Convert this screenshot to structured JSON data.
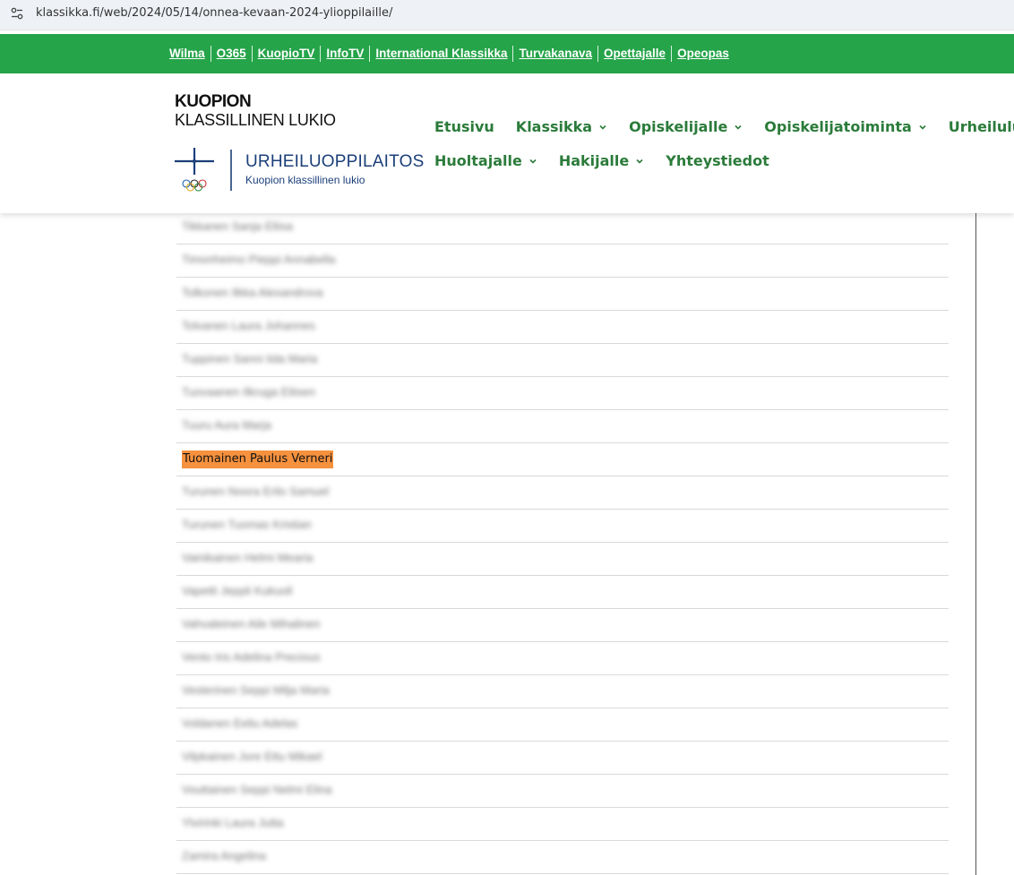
{
  "browser": {
    "url": "klassikka.fi/web/2024/05/14/onnea-kevaan-2024-ylioppilaille/",
    "site_info_icon": "tune-icon"
  },
  "topbar": {
    "links": [
      "Wilma",
      "O365",
      "KuopioTV",
      "InfoTV",
      "International Klassikka",
      "Turvakanava",
      "Opettajalle",
      "Opeopas"
    ]
  },
  "logo": {
    "line1": "KUOPION",
    "line2": "KLASSILLINEN LUKIO",
    "sport_title": "URHEILUOPPILAITOS",
    "sport_subtitle": "Kuopion klassillinen lukio"
  },
  "nav": {
    "row1": [
      {
        "label": "Etusivu",
        "dropdown": false
      },
      {
        "label": "Klassikka",
        "dropdown": true
      },
      {
        "label": "Opiskelijalle",
        "dropdown": true
      },
      {
        "label": "Opiskelijatoiminta",
        "dropdown": true
      },
      {
        "label": "Urheilulukio",
        "dropdown": true
      }
    ],
    "row2": [
      {
        "label": "Huoltajalle",
        "dropdown": true
      },
      {
        "label": "Hakijalle",
        "dropdown": true
      },
      {
        "label": "Yhteystiedot",
        "dropdown": false
      }
    ]
  },
  "list": {
    "highlighted_name": "Tuomainen Paulus Verneri",
    "rows": [
      {
        "blurred": true,
        "placeholder": "Tikkanen Sanja Eliisa"
      },
      {
        "blurred": true,
        "placeholder": "Timonheimo Pieppi Annabella"
      },
      {
        "blurred": true,
        "placeholder": "Tolkonen Ilkka Alexandrova"
      },
      {
        "blurred": true,
        "placeholder": "Tolvanen Laura Johannes"
      },
      {
        "blurred": true,
        "placeholder": "Tuppinen Sanni Iida Maria"
      },
      {
        "blurred": true,
        "placeholder": "Tuovaanen Ilkruga Eliisen"
      },
      {
        "blurred": true,
        "placeholder": "Tuuru Aura Marja"
      },
      {
        "blurred": false,
        "placeholder": "Tuomainen Paulus Verneri"
      },
      {
        "blurred": true,
        "placeholder": "Turunen Noora Erilo Samuel"
      },
      {
        "blurred": true,
        "placeholder": "Turunen Tuomas Kristian"
      },
      {
        "blurred": true,
        "placeholder": "Vainikainen Helmi Mearia"
      },
      {
        "blurred": true,
        "placeholder": "Vapetti Jeppli Kukuoll"
      },
      {
        "blurred": true,
        "placeholder": "Vahvaleinen Aile Mihalinen"
      },
      {
        "blurred": true,
        "placeholder": "Vento Iris Adelina Precious"
      },
      {
        "blurred": true,
        "placeholder": "Vesterinen Seppi Milja Maria"
      },
      {
        "blurred": true,
        "placeholder": "Voldanen Eeliu Adelas"
      },
      {
        "blurred": true,
        "placeholder": "Vilpkainen Jore Ettu Mikael"
      },
      {
        "blurred": true,
        "placeholder": "Vouttainen Seppi Nelmi Elina"
      },
      {
        "blurred": true,
        "placeholder": "Ylvirinki Laura Jutta"
      },
      {
        "blurred": true,
        "placeholder": "Zamira Angelina"
      }
    ]
  },
  "colors": {
    "topbar": "#25a449",
    "nav_text": "#2b7b3a",
    "highlight": "#f6913e",
    "logo_blue": "#1b3f7a"
  }
}
